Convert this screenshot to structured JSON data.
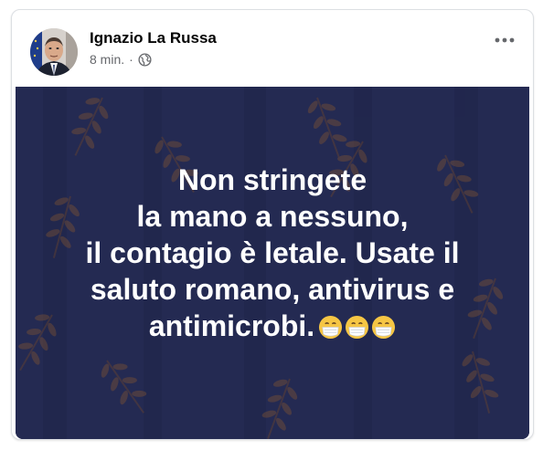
{
  "post": {
    "author": "Ignazio La Russa",
    "time": "8 min.",
    "separator": "·",
    "privacy_icon": "globe-icon",
    "menu_icon": "more-options-icon"
  },
  "image": {
    "text": "Non stringete\nla mano a nessuno,\nil contagio è letale. Usate il\nsaluto romano, antivirus e\nantimicrobi.",
    "emoji": "face-with-medical-mask",
    "emoji_count": 3,
    "background_color": "#242a52"
  },
  "colors": {
    "author_text": "#050505",
    "secondary_text": "#65676b",
    "image_text": "#ffffff",
    "leaf_pattern": "#6a4a3a"
  }
}
